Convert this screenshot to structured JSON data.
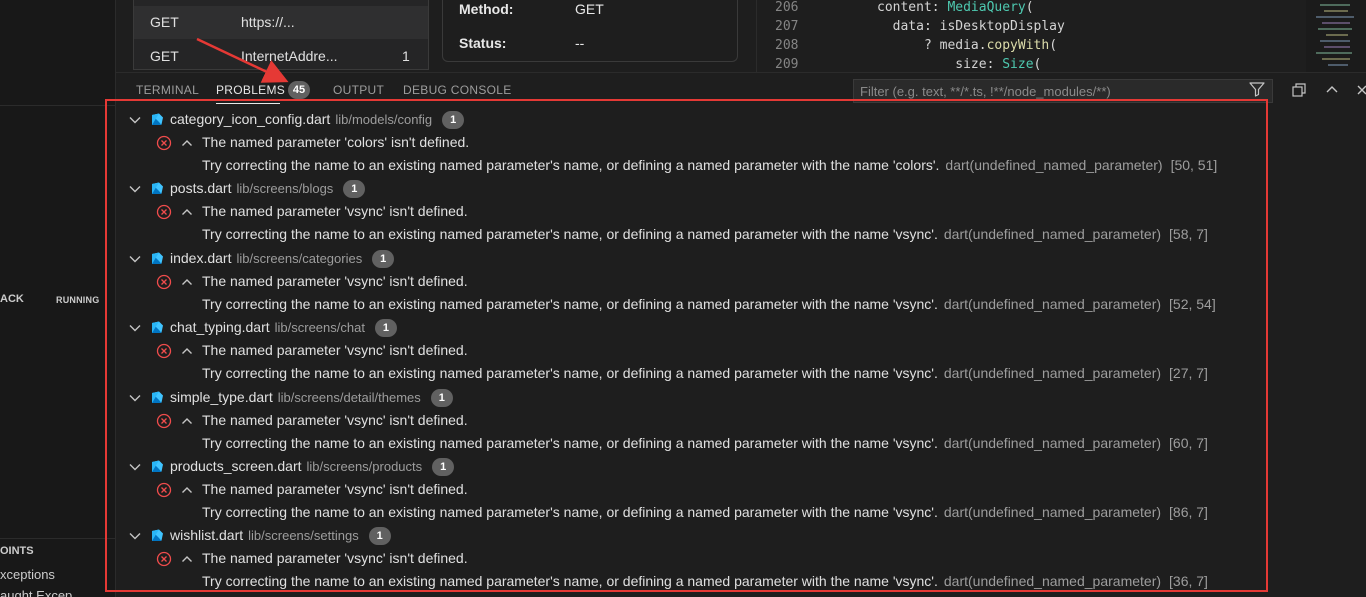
{
  "sidebar": {
    "call_stack_label": "ACK",
    "running_label": "RUNNING",
    "breakpoints_label": "OINTS",
    "exceptions_label": "xceptions",
    "uncaught_label": "aught Excep"
  },
  "network": {
    "rows": [
      {
        "method": "GET",
        "url": "https://...",
        "count": ""
      },
      {
        "method": "GET",
        "url": "InternetAddre...",
        "count": "1"
      }
    ]
  },
  "request": {
    "method_label": "Method:",
    "method_value": "GET",
    "status_label": "Status:",
    "status_value": "--"
  },
  "editor": {
    "lines": [
      {
        "number": "206",
        "pre": "content: ",
        "token": "MediaQuery",
        "post": "("
      },
      {
        "number": "207",
        "pre": "  data: isDesktopDisplay",
        "token": "",
        "post": ""
      },
      {
        "number": "208",
        "pre": "      ? media.",
        "token": "copyWith",
        "post": "("
      },
      {
        "number": "209",
        "pre": "          size: ",
        "token": "Size",
        "post": "("
      }
    ]
  },
  "panel": {
    "tabs": [
      {
        "label": "TERMINAL",
        "active": false
      },
      {
        "label": "PROBLEMS",
        "active": true
      },
      {
        "label": "OUTPUT",
        "active": false
      },
      {
        "label": "DEBUG CONSOLE",
        "active": false
      }
    ],
    "problems_count": "45",
    "filter_placeholder": "Filter (e.g. text, **/*.ts, !**/node_modules/**)"
  },
  "problems": [
    {
      "file": "category_icon_config.dart",
      "path": "lib/models/config",
      "count": "1",
      "message": "The named parameter 'colors' isn't defined.",
      "detail": "Try correcting the name to an existing named parameter's name, or defining a named parameter with the name 'colors'.",
      "source": "dart(undefined_named_parameter)",
      "location": "[50, 51]"
    },
    {
      "file": "posts.dart",
      "path": "lib/screens/blogs",
      "count": "1",
      "message": "The named parameter 'vsync' isn't defined.",
      "detail": "Try correcting the name to an existing named parameter's name, or defining a named parameter with the name 'vsync'.",
      "source": "dart(undefined_named_parameter)",
      "location": "[58, 7]"
    },
    {
      "file": "index.dart",
      "path": "lib/screens/categories",
      "count": "1",
      "message": "The named parameter 'vsync' isn't defined.",
      "detail": "Try correcting the name to an existing named parameter's name, or defining a named parameter with the name 'vsync'.",
      "source": "dart(undefined_named_parameter)",
      "location": "[52, 54]"
    },
    {
      "file": "chat_typing.dart",
      "path": "lib/screens/chat",
      "count": "1",
      "message": "The named parameter 'vsync' isn't defined.",
      "detail": "Try correcting the name to an existing named parameter's name, or defining a named parameter with the name 'vsync'.",
      "source": "dart(undefined_named_parameter)",
      "location": "[27, 7]"
    },
    {
      "file": "simple_type.dart",
      "path": "lib/screens/detail/themes",
      "count": "1",
      "message": "The named parameter 'vsync' isn't defined.",
      "detail": "Try correcting the name to an existing named parameter's name, or defining a named parameter with the name 'vsync'.",
      "source": "dart(undefined_named_parameter)",
      "location": "[60, 7]"
    },
    {
      "file": "products_screen.dart",
      "path": "lib/screens/products",
      "count": "1",
      "message": "The named parameter 'vsync' isn't defined.",
      "detail": "Try correcting the name to an existing named parameter's name, or defining a named parameter with the name 'vsync'.",
      "source": "dart(undefined_named_parameter)",
      "location": "[86, 7]"
    },
    {
      "file": "wishlist.dart",
      "path": "lib/screens/settings",
      "count": "1",
      "message": "The named parameter 'vsync' isn't defined.",
      "detail": "Try correcting the name to an existing named parameter's name, or defining a named parameter with the name 'vsync'.",
      "source": "dart(undefined_named_parameter)",
      "location": "[36, 7]"
    }
  ],
  "colors": {
    "annotation": "#e53935",
    "error": "#f14c4c",
    "dart_blue": "#40c4ff"
  }
}
